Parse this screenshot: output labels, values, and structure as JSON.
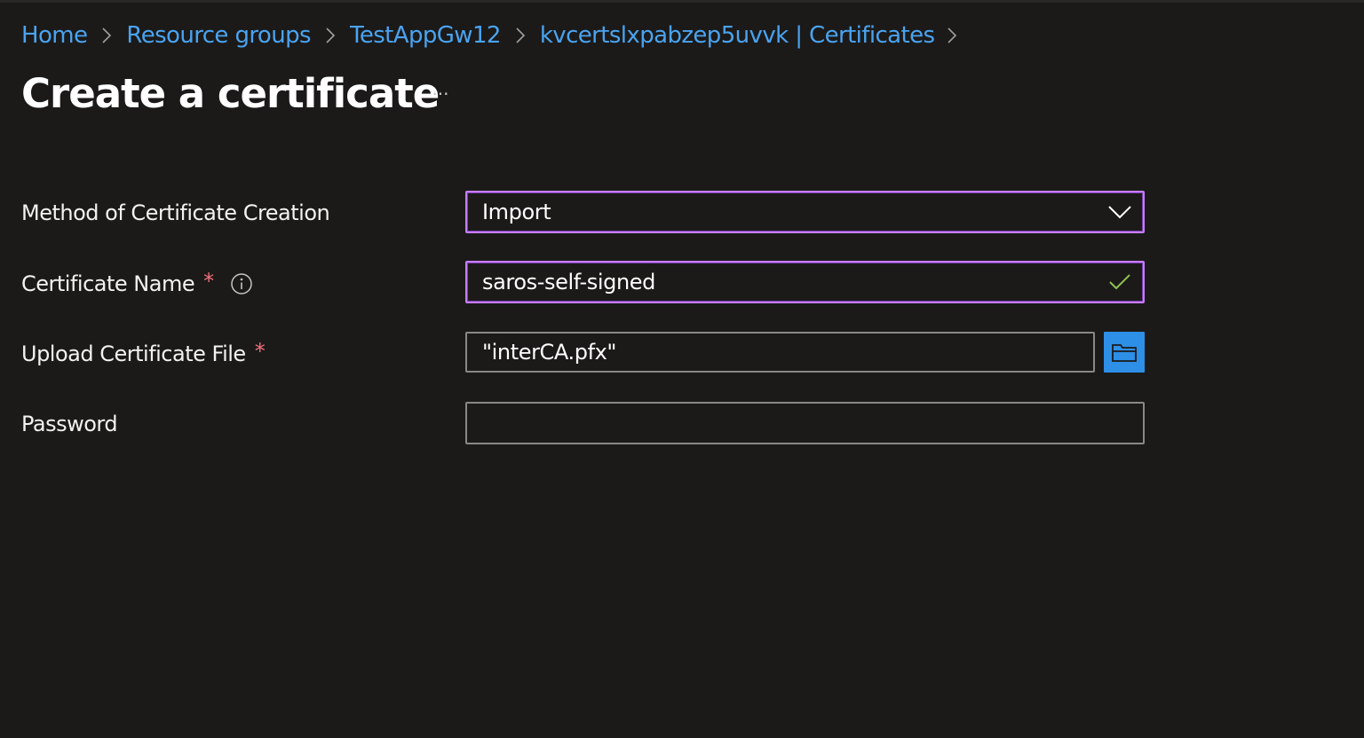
{
  "breadcrumb": {
    "items": [
      {
        "label": "Home"
      },
      {
        "label": "Resource groups"
      },
      {
        "label": "TestAppGw12"
      },
      {
        "label": "kvcertslxpabzep5uvvk | Certificates"
      }
    ],
    "separator_icon": "chevron-right-icon"
  },
  "header": {
    "title": "Create a certificate",
    "more_icon": "ellipsis-icon",
    "more_label": "···"
  },
  "form": {
    "method": {
      "label": "Method of Certificate Creation",
      "value": "Import",
      "icon": "chevron-down-icon"
    },
    "name": {
      "label": "Certificate Name",
      "required_mark": "*",
      "value": "saros-self-signed",
      "valid_icon": "checkmark-icon",
      "info_icon": "info-icon"
    },
    "upload": {
      "label": "Upload Certificate File",
      "required_mark": "*",
      "value": "\"interCA.pfx\"",
      "browse_icon": "folder-icon"
    },
    "password": {
      "label": "Password",
      "value": ""
    }
  },
  "colors": {
    "background": "#1b1a19",
    "link": "#4aa3f0",
    "focus_border": "#c77dff",
    "valid": "#92c353",
    "required": "#f1707b",
    "browse_button": "#2d8fe6"
  }
}
